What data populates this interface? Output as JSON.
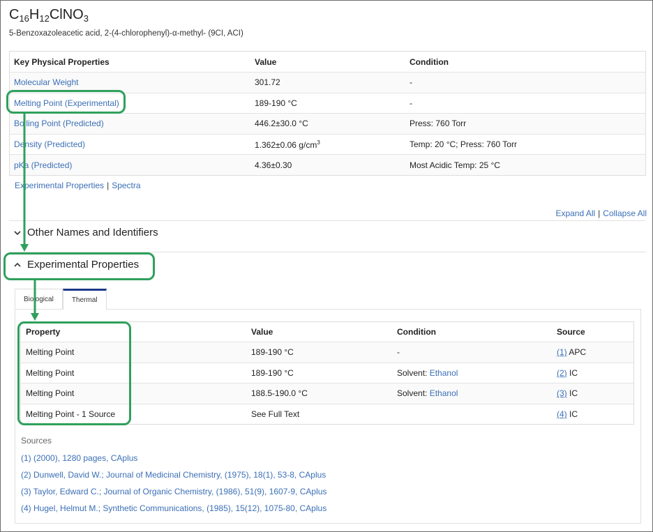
{
  "compound": {
    "formula_parts": [
      {
        "text": "C",
        "sub": "16"
      },
      {
        "text": "H",
        "sub": "12"
      },
      {
        "text": "ClNO",
        "sub": "3"
      }
    ],
    "name": "5-Benzoxazoleacetic acid, 2-(4-chlorophenyl)-α-methyl- (9CI, ACI)"
  },
  "key_properties": {
    "headers": [
      "Key Physical Properties",
      "Value",
      "Condition"
    ],
    "rows": [
      {
        "property": "Molecular Weight",
        "value": "301.72",
        "value_sup": "",
        "condition": "-"
      },
      {
        "property": "Melting Point (Experimental)",
        "value": "189-190 °C",
        "value_sup": "",
        "condition": "-"
      },
      {
        "property": "Boiling Point (Predicted)",
        "value": "446.2±30.0 °C",
        "value_sup": "",
        "condition": "Press: 760 Torr"
      },
      {
        "property": "Density (Predicted)",
        "value": "1.362±0.06 g/cm",
        "value_sup": "3",
        "condition": "Temp: 20 °C; Press: 760 Torr"
      },
      {
        "property": "pKa (Predicted)",
        "value": "4.36±0.30",
        "value_sup": "",
        "condition": "Most Acidic Temp: 25 °C"
      }
    ],
    "links": [
      "Experimental Properties",
      "Spectra"
    ],
    "link_separator": "|"
  },
  "expand_controls": {
    "expand_all": "Expand All",
    "separator": "|",
    "collapse_all": "Collapse All"
  },
  "sections": {
    "other_names": {
      "title": "Other Names and Identifiers",
      "state": "collapsed"
    },
    "experimental": {
      "title": "Experimental Properties",
      "state": "expanded"
    }
  },
  "tabs": [
    {
      "label": "Biological",
      "active": false
    },
    {
      "label": "Thermal",
      "active": true
    }
  ],
  "experimental_table": {
    "headers": [
      "Property",
      "Value",
      "Condition",
      "Source"
    ],
    "rows": [
      {
        "property": "Melting Point",
        "value": "189-190 °C",
        "condition_prefix": "-",
        "condition_link": "",
        "source_num": "(1)",
        "source_code": "APC"
      },
      {
        "property": "Melting Point",
        "value": "189-190 °C",
        "condition_prefix": "Solvent: ",
        "condition_link": "Ethanol",
        "source_num": "(2)",
        "source_code": "IC"
      },
      {
        "property": "Melting Point",
        "value": "188.5-190.0 °C",
        "condition_prefix": "Solvent: ",
        "condition_link": "Ethanol",
        "source_num": "(3)",
        "source_code": "IC"
      },
      {
        "property": "Melting Point - 1 Source",
        "value": "See Full Text",
        "condition_prefix": "",
        "condition_link": "",
        "source_num": "(4)",
        "source_code": "IC"
      }
    ]
  },
  "sources": {
    "title": "Sources",
    "items": [
      "(1) (2000), 1280 pages, CAplus",
      "(2) Dunwell, David W.; Journal of Medicinal Chemistry, (1975), 18(1), 53-8, CAplus",
      "(3) Taylor, Edward C.; Journal of Organic Chemistry, (1986), 51(9), 1607-9, CAplus",
      "(4) Hugel, Helmut M.; Synthetic Communications, (1985), 15(12), 1075-80, CAplus"
    ]
  },
  "colors": {
    "link": "#3b6fb6",
    "highlight": "#2fa05c",
    "active_tab": "#1c3a8a"
  },
  "icons": {
    "collapsed": "chevron-down-icon",
    "expanded": "chevron-up-icon"
  }
}
